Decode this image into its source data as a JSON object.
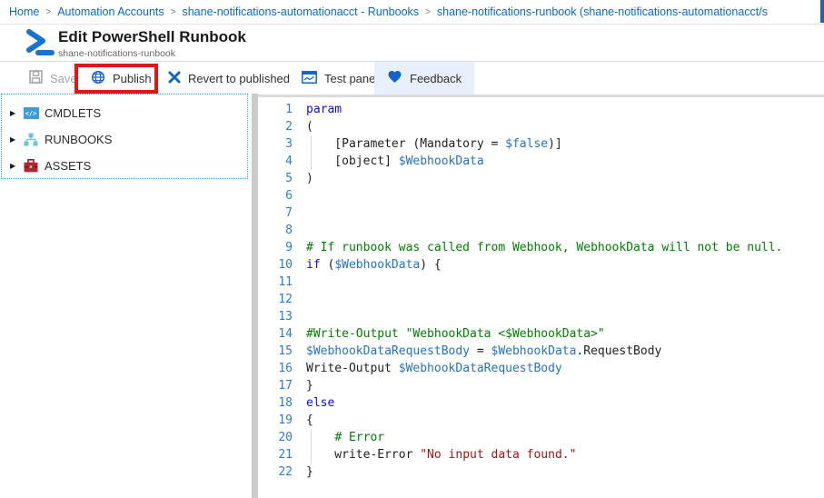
{
  "breadcrumb": {
    "separator": ">",
    "items": [
      "Home",
      "Automation Accounts",
      "shane-notifications-automationacct - Runbooks",
      "shane-notifications-runbook (shane-notifications-automationacct/s"
    ]
  },
  "header": {
    "title": "Edit PowerShell Runbook",
    "subtitle": "shane-notifications-runbook"
  },
  "toolbar": {
    "save": "Save",
    "publish": "Publish",
    "revert": "Revert to published",
    "test_pane": "Test pane",
    "feedback": "Feedback"
  },
  "sidebar": {
    "items": [
      {
        "label": "CMDLETS",
        "icon": "cmdlets-icon",
        "glyph": "</>"
      },
      {
        "label": "RUNBOOKS",
        "icon": "runbooks-icon"
      },
      {
        "label": "ASSETS",
        "icon": "assets-icon"
      }
    ]
  },
  "colors": {
    "accent": "#1464c8",
    "link": "#0a69c6",
    "annotation_red": "#e01717",
    "sidebar_border": "#29abe2",
    "kw": "#0e0ee0",
    "var": "#2472c8",
    "com": "#008000",
    "str": "#a31515",
    "def": "#1f1f1f",
    "line_number": "#2e7bd1"
  },
  "editor": {
    "indent_guides": [
      {
        "from": 3,
        "to": 4
      },
      {
        "from": 20,
        "to": 21
      }
    ],
    "lines": [
      {
        "n": 1,
        "segs": [
          {
            "t": "param",
            "c": "kw"
          }
        ]
      },
      {
        "n": 2,
        "segs": [
          {
            "t": "(",
            "c": "def"
          }
        ]
      },
      {
        "n": 3,
        "segs": [
          {
            "t": "    [Parameter (Mandatory = ",
            "c": "def"
          },
          {
            "t": "$false",
            "c": "var"
          },
          {
            "t": ")]",
            "c": "def"
          }
        ]
      },
      {
        "n": 4,
        "segs": [
          {
            "t": "    [object] ",
            "c": "def"
          },
          {
            "t": "$WebhookData",
            "c": "var"
          }
        ]
      },
      {
        "n": 5,
        "segs": [
          {
            "t": ")",
            "c": "def"
          }
        ]
      },
      {
        "n": 6,
        "segs": []
      },
      {
        "n": 7,
        "segs": []
      },
      {
        "n": 8,
        "segs": []
      },
      {
        "n": 9,
        "segs": [
          {
            "t": "# If runbook was called from Webhook, WebhookData will not be null.",
            "c": "com"
          }
        ]
      },
      {
        "n": 10,
        "segs": [
          {
            "t": "if",
            "c": "kw"
          },
          {
            "t": " (",
            "c": "def"
          },
          {
            "t": "$WebhookData",
            "c": "var"
          },
          {
            "t": ") {",
            "c": "def"
          }
        ]
      },
      {
        "n": 11,
        "segs": []
      },
      {
        "n": 12,
        "segs": []
      },
      {
        "n": 13,
        "segs": []
      },
      {
        "n": 14,
        "segs": [
          {
            "t": "#Write-Output \"WebhookData <$WebhookData>\"",
            "c": "com"
          }
        ]
      },
      {
        "n": 15,
        "segs": [
          {
            "t": "$WebhookDataRequestBody",
            "c": "var"
          },
          {
            "t": " = ",
            "c": "def"
          },
          {
            "t": "$WebhookData",
            "c": "var"
          },
          {
            "t": ".RequestBody",
            "c": "def"
          }
        ]
      },
      {
        "n": 16,
        "segs": [
          {
            "t": "Write-Output ",
            "c": "def"
          },
          {
            "t": "$WebhookDataRequestBody",
            "c": "var"
          }
        ]
      },
      {
        "n": 17,
        "segs": [
          {
            "t": "}",
            "c": "def"
          }
        ]
      },
      {
        "n": 18,
        "segs": [
          {
            "t": "else",
            "c": "kw"
          }
        ]
      },
      {
        "n": 19,
        "segs": [
          {
            "t": "{",
            "c": "def"
          }
        ]
      },
      {
        "n": 20,
        "segs": [
          {
            "t": "    ",
            "c": "def"
          },
          {
            "t": "# Error",
            "c": "com"
          }
        ]
      },
      {
        "n": 21,
        "segs": [
          {
            "t": "    write-Error ",
            "c": "def"
          },
          {
            "t": "\"No input data found.\"",
            "c": "str"
          }
        ]
      },
      {
        "n": 22,
        "segs": [
          {
            "t": "}",
            "c": "def"
          }
        ]
      }
    ]
  }
}
